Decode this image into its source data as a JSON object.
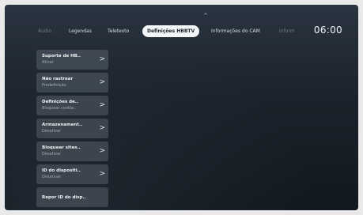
{
  "tabs": [
    {
      "label": "Áudio",
      "state": "faded"
    },
    {
      "label": "Legendas",
      "state": "normal"
    },
    {
      "label": "Teletexto",
      "state": "normal"
    },
    {
      "label": "Definições HBBTV",
      "state": "active"
    },
    {
      "label": "Informações do CAM",
      "state": "normal"
    },
    {
      "label": "Inform",
      "state": "faded"
    }
  ],
  "clock": "06:00",
  "scroll_indicator": "^",
  "menu": [
    {
      "title": "Suporte de HB..",
      "value": "Ativar",
      "chevron": ">"
    },
    {
      "title": "Não rastrear",
      "value": "Predefinição",
      "chevron": ">"
    },
    {
      "title": "Definições de..",
      "value": "Bloquear cookie..",
      "chevron": ">"
    },
    {
      "title": "Armazenament..",
      "value": "Desativar",
      "chevron": ">"
    },
    {
      "title": "Bloquear sites..",
      "value": "Desativar",
      "chevron": ">"
    },
    {
      "title": "ID do dispositi..",
      "value": "Desativar",
      "chevron": ">"
    },
    {
      "title": "Repor ID do disp..",
      "value": "",
      "chevron": ""
    }
  ]
}
